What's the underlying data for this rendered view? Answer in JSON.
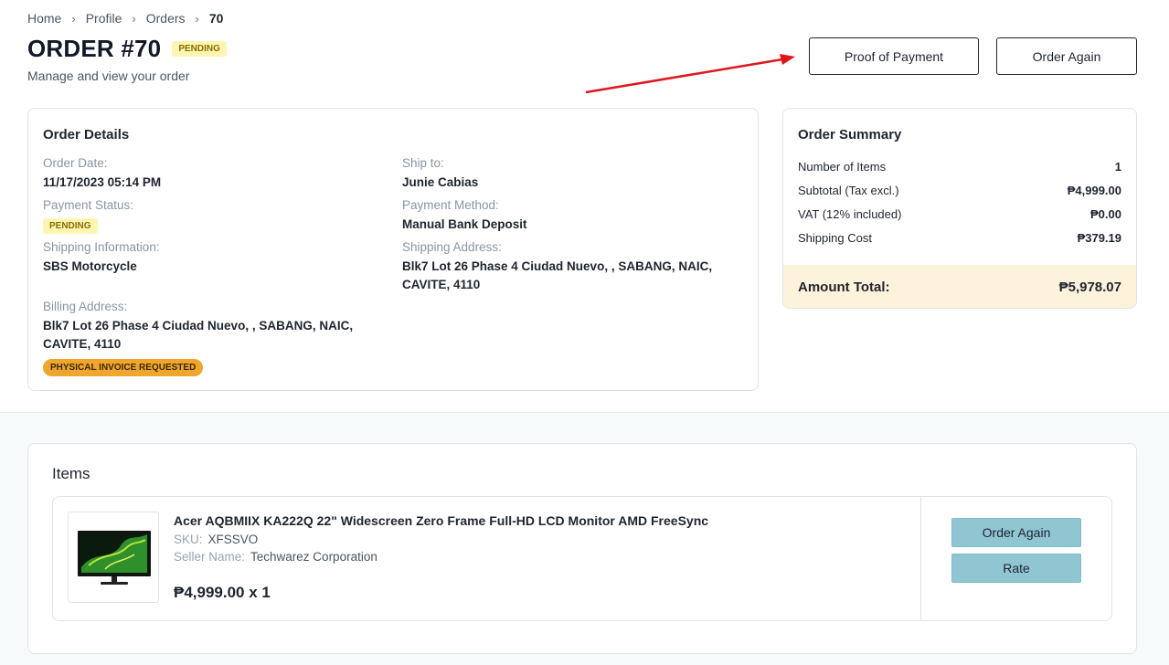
{
  "breadcrumb": {
    "items": [
      "Home",
      "Profile",
      "Orders"
    ],
    "current": "70"
  },
  "header": {
    "title": "ORDER #70",
    "status_badge": "PENDING",
    "subtitle": "Manage and view your order",
    "proof_of_payment_label": "Proof of Payment",
    "order_again_label": "Order Again"
  },
  "order_details": {
    "title": "Order Details",
    "order_date_label": "Order Date:",
    "order_date": "11/17/2023 05:14 PM",
    "ship_to_label": "Ship to:",
    "ship_to": "Junie Cabias",
    "payment_status_label": "Payment Status:",
    "payment_status": "PENDING",
    "payment_method_label": "Payment Method:",
    "payment_method": "Manual Bank Deposit",
    "shipping_info_label": "Shipping Information:",
    "shipping_info": "SBS Motorcycle",
    "shipping_address_label": "Shipping Address:",
    "shipping_address": "Blk7 Lot 26 Phase 4 Ciudad Nuevo, , SABANG, NAIC, CAVITE, 4110",
    "billing_address_label": "Billing Address:",
    "billing_address": "Blk7 Lot 26 Phase 4 Ciudad Nuevo, , SABANG, NAIC, CAVITE, 4110",
    "invoice_badge": "PHYSICAL INVOICE REQUESTED"
  },
  "order_summary": {
    "title": "Order Summary",
    "rows": [
      {
        "label": "Number of Items",
        "value": "1"
      },
      {
        "label": "Subtotal (Tax excl.)",
        "value": "₱4,999.00"
      },
      {
        "label": "VAT (12% included)",
        "value": "₱0.00"
      },
      {
        "label": "Shipping Cost",
        "value": "₱379.19"
      }
    ],
    "total_label": "Amount Total:",
    "total_value": "₱5,978.07"
  },
  "items": {
    "title": "Items",
    "list": [
      {
        "name": "Acer AQBMIIX KA222Q 22\" Widescreen Zero Frame Full-HD LCD Monitor AMD FreeSync",
        "sku_label": "SKU:",
        "sku": "XFSSVO",
        "seller_label": "Seller Name:",
        "seller": "Techwarez Corporation",
        "price": "₱4,999.00 x 1",
        "order_again_label": "Order Again",
        "rate_label": "Rate",
        "image_icon": "monitor-icon"
      }
    ]
  },
  "colors": {
    "pending_badge_bg": "#fdf6b2",
    "invoice_badge_bg": "#f0a52c",
    "total_row_bg": "#fdf3da",
    "teal_button": "#8fc6d2",
    "annotation_arrow": "#e0161b"
  }
}
